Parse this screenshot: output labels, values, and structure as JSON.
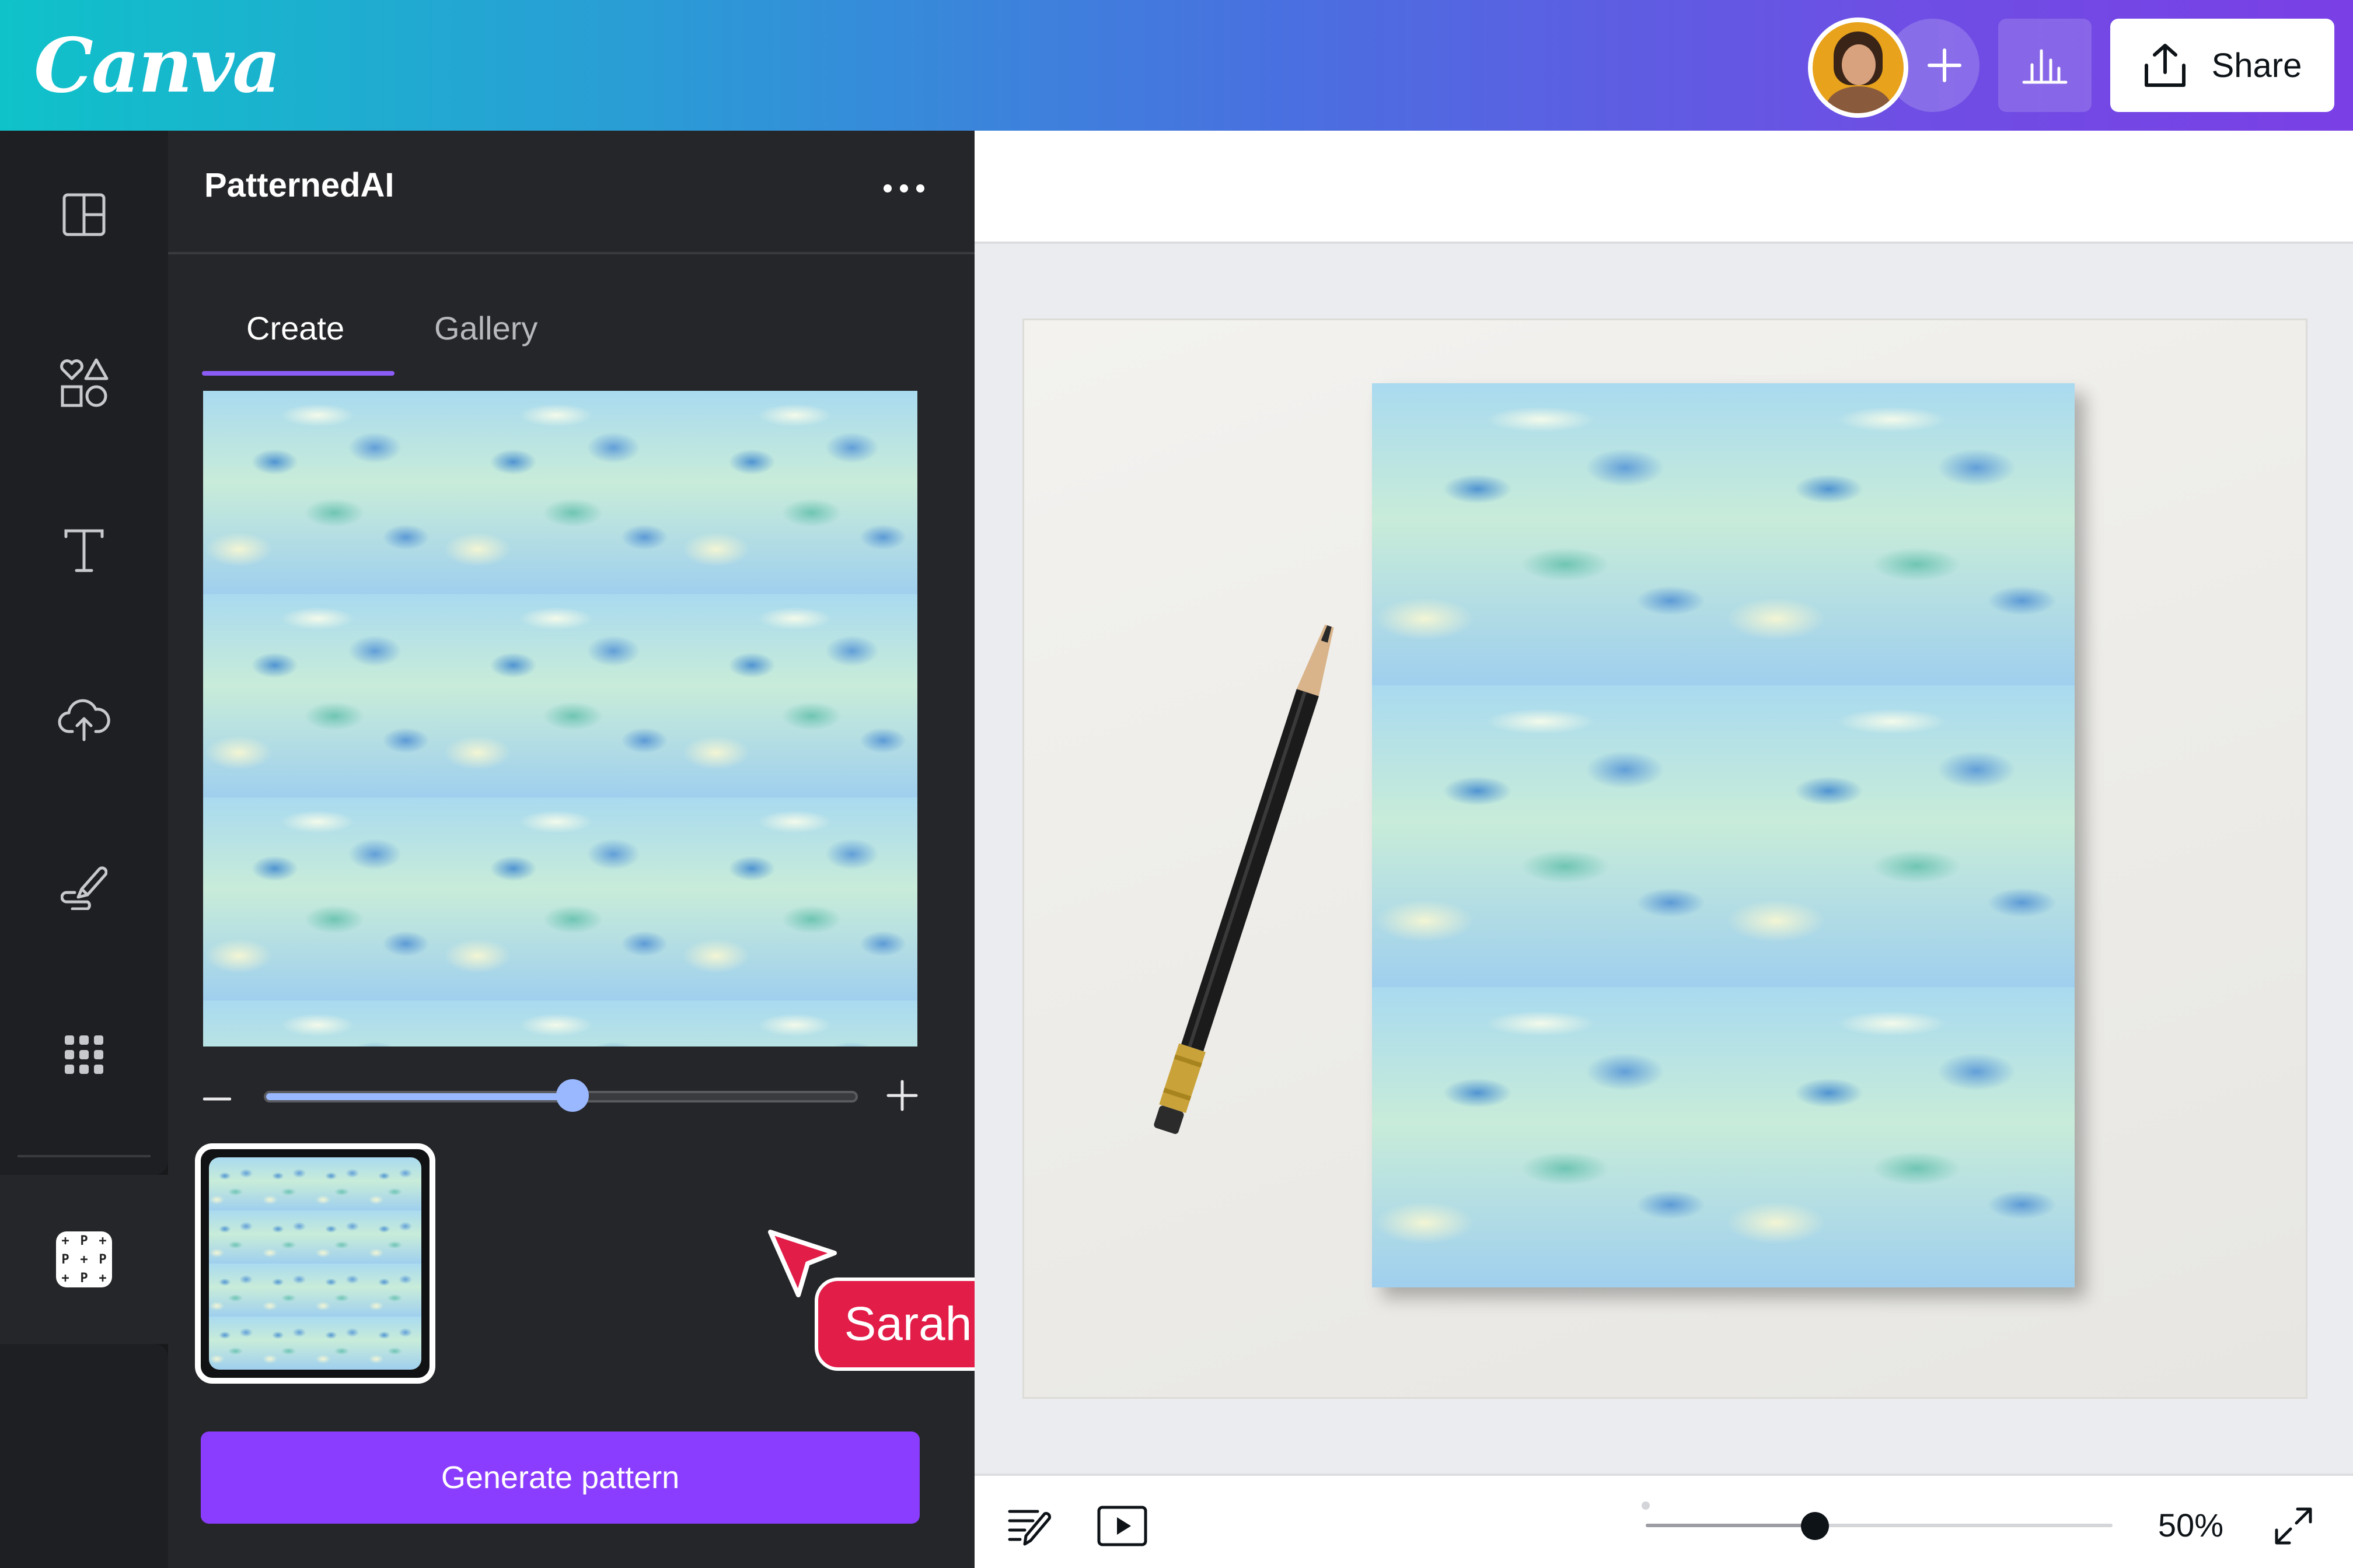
{
  "app": {
    "logo_text": "Canva"
  },
  "header": {
    "share_label": "Share",
    "invite_icon": "plus-icon",
    "stats_icon": "bar-chart-icon",
    "share_icon": "upload-icon"
  },
  "rail": {
    "items": [
      {
        "icon": "layout-icon"
      },
      {
        "icon": "elements-icon"
      },
      {
        "icon": "text-icon"
      },
      {
        "icon": "upload-cloud-icon"
      },
      {
        "icon": "draw-icon"
      },
      {
        "icon": "apps-grid-icon"
      }
    ],
    "active_app_icon": "patterned-ai-app-icon"
  },
  "panel": {
    "title": "PatternedAI",
    "tabs": [
      {
        "label": "Create",
        "active": true
      },
      {
        "label": "Gallery",
        "active": false
      }
    ],
    "scale_slider_value": 0.52,
    "generate_label": "Generate pattern"
  },
  "collaborator": {
    "name": "Sarah",
    "color": "#e11d48"
  },
  "footer": {
    "zoom_label": "50%",
    "zoom_slider_value": 0.5
  },
  "colors": {
    "accent": "#8b3dff",
    "panel_bg": "#252629",
    "rail_bg": "#1e1f22",
    "canvas_bg": "#ebecf0"
  }
}
